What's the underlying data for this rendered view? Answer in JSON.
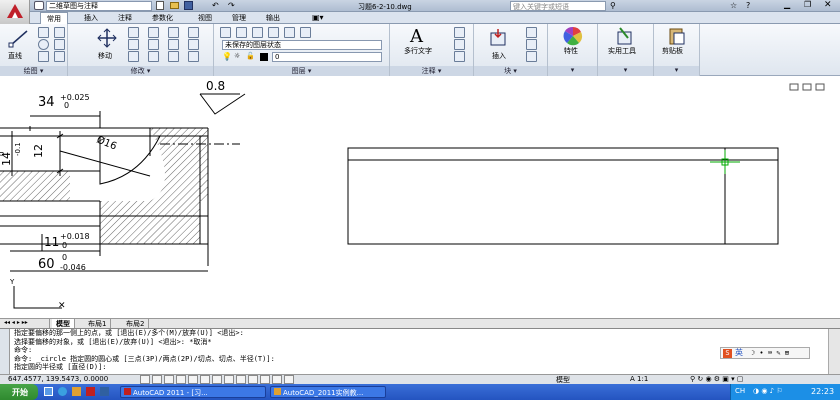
{
  "titlebar": {
    "workspace": "二维草图与注释",
    "filename": "习题6-2-10.dwg",
    "search_placeholder": "键入关键字或短语"
  },
  "ribbon_tabs": [
    "常用",
    "插入",
    "注释",
    "参数化",
    "视图",
    "管理",
    "输出"
  ],
  "panels": {
    "draw": {
      "label": "绘图",
      "line_label": "直线"
    },
    "modify": {
      "label": "修改",
      "move_label": "移动"
    },
    "layers": {
      "label": "图层",
      "layer_state": "未保存的图层状态",
      "current_layer": "0"
    },
    "annotation": {
      "label": "注释",
      "mtext_label": "多行文字"
    },
    "block": {
      "label": "块",
      "insert_label": "插入"
    },
    "properties": {
      "label": "特性"
    },
    "utilities": {
      "label": "实用工具"
    },
    "clipboard": {
      "label": "剪贴板"
    }
  },
  "drawing": {
    "dim_34": "34",
    "dim_34_upper": "+0.025",
    "dim_34_lower": "0",
    "roughness": "0.8",
    "dim_12": "12",
    "dim_14": "14",
    "dim_14_upper": "0",
    "dim_14_lower": "-0.1",
    "dim_phi16": "Ø16",
    "dim_11": "11",
    "dim_11_upper": "+0.018",
    "dim_11_lower": "0",
    "dim_60": "60",
    "dim_60_upper": "0",
    "dim_60_lower": "-0.046"
  },
  "layout_tabs": [
    "模型",
    "布局1",
    "布局2"
  ],
  "command_lines": [
    "指定要偏移的那一侧上的点，或 [退出(E)/多个(M)/放弃(U)] <退出>:",
    "选择要偏移的对象，或 [退出(E)/放弃(U)] <退出>: *取消*",
    "命令:",
    "命令: _circle 指定圆的圆心或 [三点(3P)/两点(2P)/切点、切点、半径(T)]:",
    "指定圆的半径或 [直径(D)]:"
  ],
  "ime": {
    "label": "英"
  },
  "status": {
    "coords": "647.4577, 139.5473, 0.0000",
    "model": "模型",
    "scale": "A 1:1"
  },
  "taskbar": {
    "start": "开始",
    "tasks": [
      "AutoCAD 2011 - [习...",
      "AutoCAD_2011实例教..."
    ],
    "clock": "22:23"
  },
  "colors": {
    "ribbon_bg": "#dfe6ef",
    "taskbar": "#2454c0",
    "start": "#2f8a2f",
    "crosshair": "#00aa00"
  }
}
